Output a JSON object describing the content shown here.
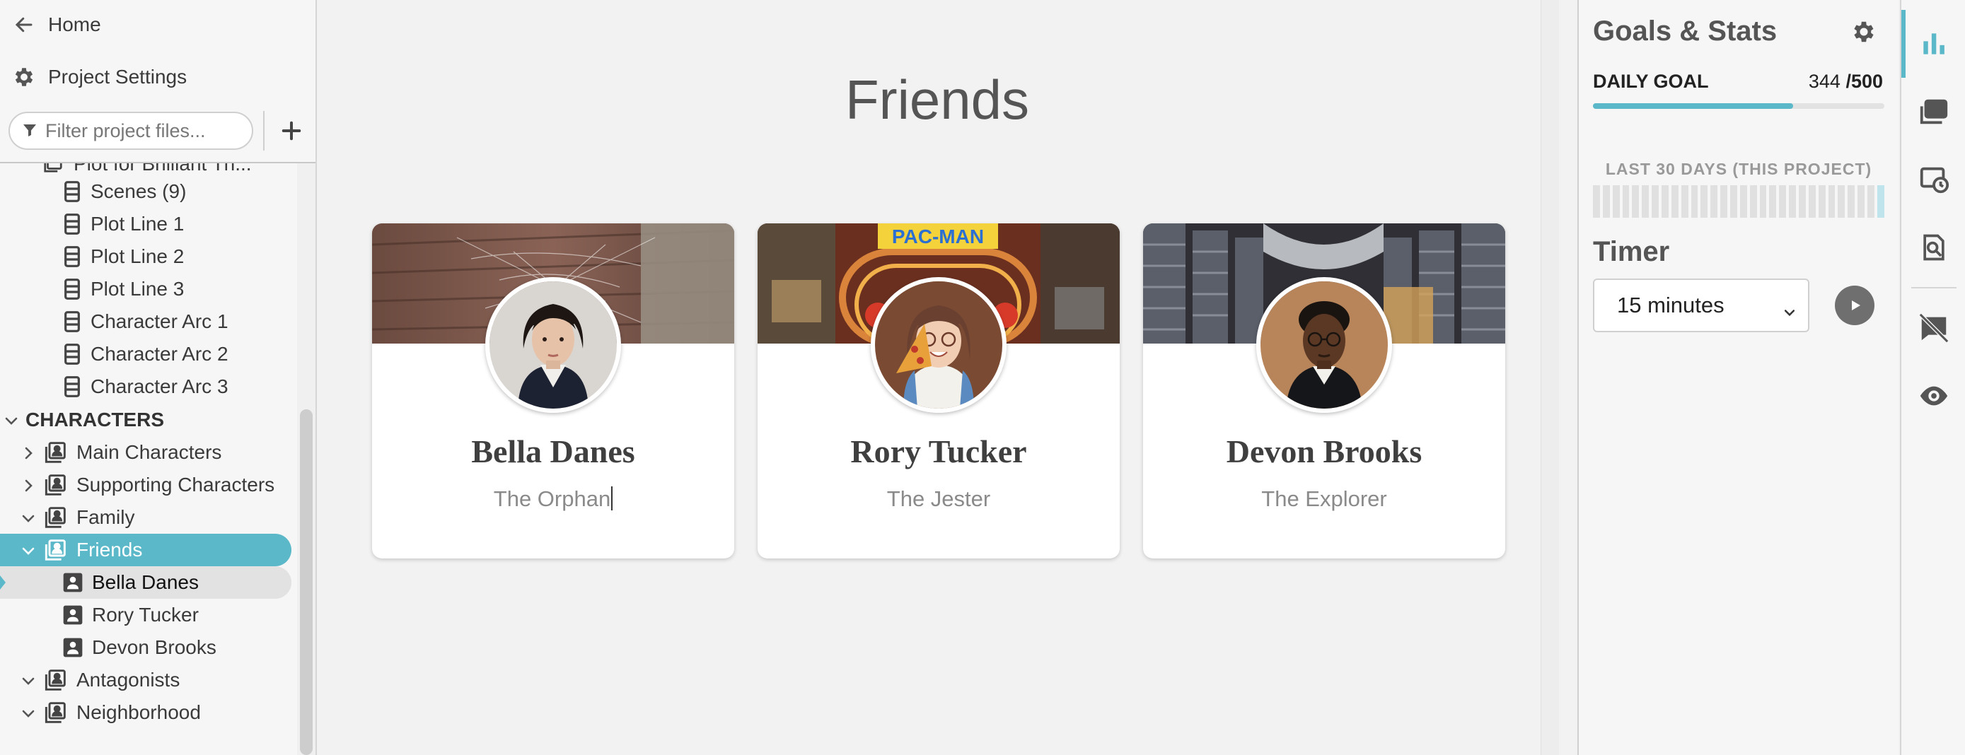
{
  "sidebar": {
    "home_label": "Home",
    "settings_label": "Project Settings",
    "filter_placeholder": "Filter project files...",
    "add_label": "+",
    "partial_row_label": "Plot for Brilliant Th...",
    "plot_items": [
      {
        "label": "Scenes  (9)"
      },
      {
        "label": "Plot Line 1"
      },
      {
        "label": "Plot Line 2"
      },
      {
        "label": "Plot Line 3"
      },
      {
        "label": "Character Arc 1"
      },
      {
        "label": "Character Arc 2"
      },
      {
        "label": "Character Arc 3"
      }
    ],
    "section_label": "CHARACTERS",
    "folders": {
      "main": "Main Characters",
      "supporting": "Supporting Characters",
      "family": "Family",
      "friends": "Friends",
      "antagonists": "Antagonists",
      "neighborhood": "Neighborhood"
    },
    "friends_items": [
      {
        "label": "Bella Danes"
      },
      {
        "label": "Rory Tucker"
      },
      {
        "label": "Devon Brooks"
      }
    ]
  },
  "main": {
    "title": "Friends",
    "cards": [
      {
        "name": "Bella Danes",
        "role": "The Orphan"
      },
      {
        "name": "Rory Tucker",
        "role": "The Jester"
      },
      {
        "name": "Devon Brooks",
        "role": "The Explorer"
      }
    ],
    "banner_sign_text": "PAC-MAN"
  },
  "stats": {
    "title": "Goals & Stats",
    "daily_goal_label": "DAILY GOAL",
    "daily_goal_current": "344",
    "daily_goal_target": "/500",
    "daily_goal_progress": 0.688,
    "last30_label": "LAST 30 DAYS (THIS PROJECT)",
    "timer_title": "Timer",
    "timer_value": "15 minutes"
  },
  "colors": {
    "accent": "#5bb8c9",
    "sidebar_bg": "#f6f6f6",
    "main_bg": "#f2f2f2"
  },
  "icons": {
    "rail": [
      "bar-chart-icon",
      "cards-icon",
      "history-icon",
      "search-document-icon",
      "comment-off-icon",
      "eye-icon"
    ]
  }
}
